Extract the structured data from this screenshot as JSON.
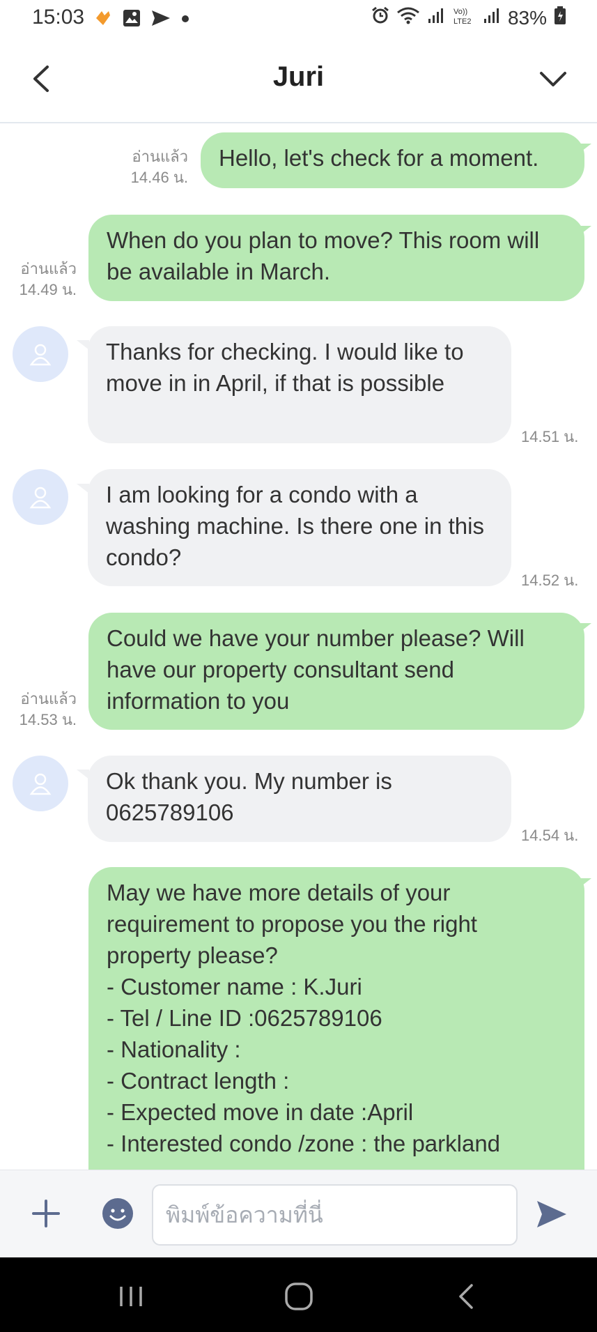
{
  "status_bar": {
    "time": "15:03",
    "battery": "83%",
    "icons_left": [
      "flame-icon",
      "image-icon",
      "send-icon",
      "dot-icon"
    ],
    "icons_right": [
      "alarm-icon",
      "wifi-icon",
      "signal-icon",
      "volte-icon",
      "signal-icon",
      "battery-icon"
    ]
  },
  "header": {
    "title": "Juri",
    "back_icon": "chevron-left-icon",
    "menu_icon": "chevron-down-icon"
  },
  "messages": [
    {
      "direction": "out",
      "text": "Hello, let's check for a moment.",
      "read_label": "อ่านแล้ว",
      "time": "14.46 น."
    },
    {
      "direction": "out",
      "text": "When do you plan to move? This room will be available in March.",
      "read_label": "อ่านแล้ว",
      "time": "14.49 น."
    },
    {
      "direction": "in",
      "text": "Thanks for checking. I would like to move in in April, if that is possible",
      "time": "14.51 น."
    },
    {
      "direction": "in",
      "text": "I am looking for a condo with a washing machine. Is there one in this condo?",
      "time": "14.52 น."
    },
    {
      "direction": "out",
      "text": "Could we have your number please? Will have our property consultant send information to you",
      "read_label": "อ่านแล้ว",
      "time": "14.53 น."
    },
    {
      "direction": "in",
      "text": "Ok thank you. My number is 0625789106",
      "time": "14.54 น."
    },
    {
      "direction": "out",
      "lines": [
        "May we have more details of your",
        "requirement to propose you the right",
        "property please?",
        "- Customer name : K.Juri",
        "- Tel / Line ID :0625789106",
        "- Nationality :",
        "- Contract length :",
        "- Expected move in date :April",
        "- Interested condo /zone : the parkland"
      ]
    }
  ],
  "input_bar": {
    "placeholder": "พิมพ์ข้อความที่นี่",
    "value": ""
  },
  "nav_bar": {
    "buttons": [
      "recent-apps",
      "home",
      "back"
    ]
  },
  "colors": {
    "outgoing_bubble": "#b8e9b4",
    "incoming_bubble": "#f0f1f3",
    "avatar_bg": "#dfe8fa",
    "send_icon": "#5c6b8f"
  }
}
